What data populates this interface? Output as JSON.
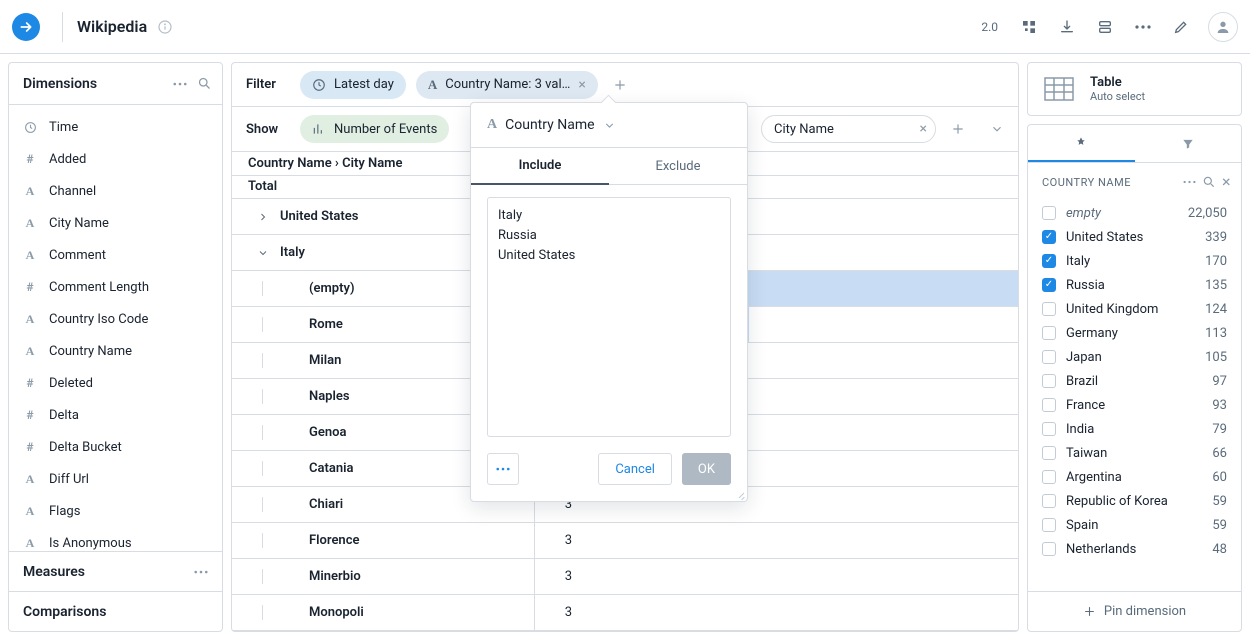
{
  "header": {
    "title": "Wikipedia",
    "version": "2.0"
  },
  "left": {
    "dimensions_label": "Dimensions",
    "items": [
      {
        "icon": "clock",
        "label": "Time"
      },
      {
        "icon": "hash",
        "label": "Added"
      },
      {
        "icon": "a",
        "label": "Channel"
      },
      {
        "icon": "a",
        "label": "City Name"
      },
      {
        "icon": "a",
        "label": "Comment"
      },
      {
        "icon": "hash",
        "label": "Comment Length"
      },
      {
        "icon": "a",
        "label": "Country Iso Code"
      },
      {
        "icon": "a",
        "label": "Country Name"
      },
      {
        "icon": "hash",
        "label": "Deleted"
      },
      {
        "icon": "hash",
        "label": "Delta"
      },
      {
        "icon": "hash",
        "label": "Delta Bucket"
      },
      {
        "icon": "a",
        "label": "Diff Url"
      },
      {
        "icon": "a",
        "label": "Flags"
      },
      {
        "icon": "a",
        "label": "Is Anonymous"
      }
    ],
    "measures_label": "Measures",
    "comparisons_label": "Comparisons"
  },
  "filter": {
    "label": "Filter",
    "time_pill": "Latest day",
    "country_pill": "Country Name: 3 val…"
  },
  "show": {
    "label": "Show",
    "measure_pill": "Number of Events",
    "split_pill": "City Name"
  },
  "table": {
    "breadcrumb": "Country Name › City Name",
    "total_label": "Total",
    "groups": [
      {
        "label": "United States",
        "expanded": false
      },
      {
        "label": "Italy",
        "expanded": true
      }
    ],
    "rows": [
      {
        "label": "(empty)",
        "bar": 100
      },
      {
        "label": "Rome",
        "bar": 38
      },
      {
        "label": "Milan",
        "bar": 0
      },
      {
        "label": "Naples",
        "bar": 0
      },
      {
        "label": "Genoa",
        "bar": 0
      },
      {
        "label": "Catania",
        "value": "",
        "bar": 0
      },
      {
        "label": "Chiari",
        "value": "3",
        "bar": 0
      },
      {
        "label": "Florence",
        "value": "3",
        "bar": 0
      },
      {
        "label": "Minerbio",
        "value": "3",
        "bar": 0
      },
      {
        "label": "Monopoli",
        "value": "3",
        "bar": 0
      }
    ]
  },
  "popover": {
    "dimension": "Country Name",
    "tab_include": "Include",
    "tab_exclude": "Exclude",
    "text": "Italy\nRussia\nUnited States",
    "cancel": "Cancel",
    "ok": "OK"
  },
  "right": {
    "viz_title": "Table",
    "viz_sub": "Auto select",
    "facet_title": "COUNTRY NAME",
    "items": [
      {
        "label": "empty",
        "count": "22,050",
        "checked": false,
        "empty": true
      },
      {
        "label": "United States",
        "count": "339",
        "checked": true
      },
      {
        "label": "Italy",
        "count": "170",
        "checked": true
      },
      {
        "label": "Russia",
        "count": "135",
        "checked": true
      },
      {
        "label": "United Kingdom",
        "count": "124",
        "checked": false
      },
      {
        "label": "Germany",
        "count": "113",
        "checked": false
      },
      {
        "label": "Japan",
        "count": "105",
        "checked": false
      },
      {
        "label": "Brazil",
        "count": "97",
        "checked": false
      },
      {
        "label": "France",
        "count": "93",
        "checked": false
      },
      {
        "label": "India",
        "count": "79",
        "checked": false
      },
      {
        "label": "Taiwan",
        "count": "66",
        "checked": false
      },
      {
        "label": "Argentina",
        "count": "60",
        "checked": false
      },
      {
        "label": "Republic of Korea",
        "count": "59",
        "checked": false
      },
      {
        "label": "Spain",
        "count": "59",
        "checked": false
      },
      {
        "label": "Netherlands",
        "count": "48",
        "checked": false
      }
    ],
    "pin_label": "Pin dimension"
  }
}
